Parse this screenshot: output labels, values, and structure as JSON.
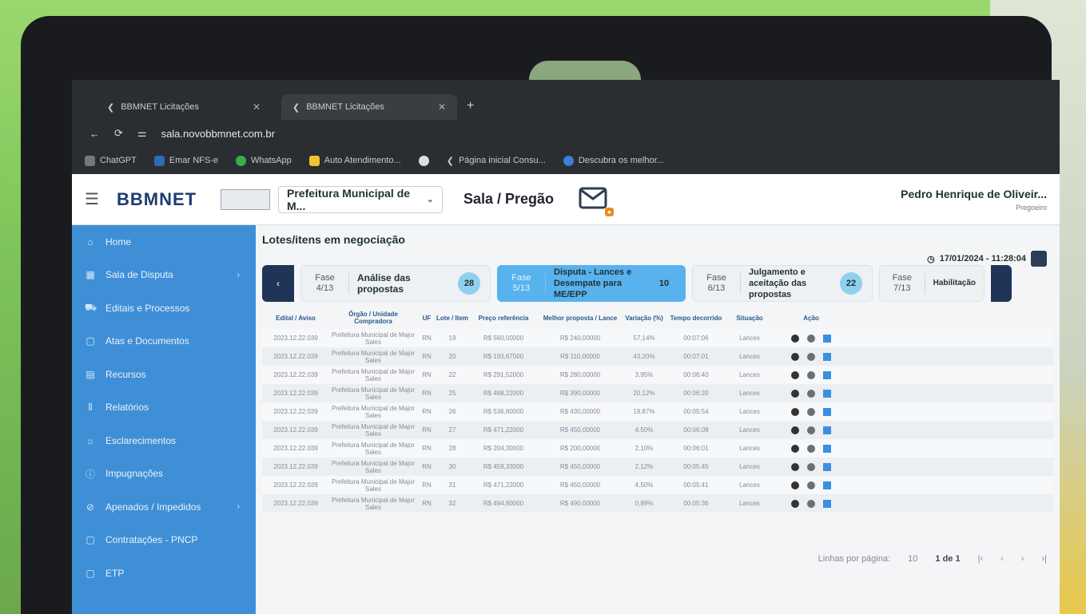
{
  "browser": {
    "tabs": [
      {
        "label": "BBMNET Licitações"
      },
      {
        "label": "BBMNET Licitações"
      }
    ],
    "url": "sala.novobbmnet.com.br",
    "bookmarks": [
      {
        "label": "ChatGPT"
      },
      {
        "label": "Emar NFS-e"
      },
      {
        "label": "WhatsApp"
      },
      {
        "label": "Auto Atendimento..."
      },
      {
        "label": "Página inicial Consu..."
      },
      {
        "label": "Descubra os melhor..."
      }
    ]
  },
  "header": {
    "logo": "BBMNET",
    "org_select": "Prefeitura Municipal de M...",
    "page_title": "Sala / Pregão",
    "user_name": "Pedro Henrique de Oliveir...",
    "user_role": "Pregoeiro"
  },
  "sidebar": {
    "items": [
      {
        "label": "Home"
      },
      {
        "label": "Sala de Disputa"
      },
      {
        "label": "Editais e Processos"
      },
      {
        "label": "Atas e Documentos"
      },
      {
        "label": "Recursos"
      },
      {
        "label": "Relatórios"
      },
      {
        "label": "Esclarecimentos"
      },
      {
        "label": "Impugnações"
      },
      {
        "label": "Apenados / Impedidos"
      },
      {
        "label": "Contratações - PNCP"
      },
      {
        "label": "ETP"
      }
    ]
  },
  "main": {
    "title": "Lotes/itens em negociação",
    "datetime": "17/01/2024 - 11:28:04",
    "phases": [
      {
        "fase": "Fase",
        "num": "4/13",
        "label": "Análise das propostas",
        "count": "28"
      },
      {
        "fase": "Fase",
        "num": "5/13",
        "label": "Disputa - Lances e Desempate para ME/EPP",
        "count": "10"
      },
      {
        "fase": "Fase",
        "num": "6/13",
        "label": "Julgamento e aceitação das propostas",
        "count": "22"
      },
      {
        "fase": "Fase",
        "num": "7/13",
        "label": "Habilitação",
        "count": ""
      }
    ],
    "columns": [
      "Edital / Aviso",
      "Órgão / Unidade Compradora",
      "UF",
      "Lote / Item",
      "Preço referência",
      "Melhor proposta / Lance",
      "Variação (%)",
      "Tempo decorrido",
      "Situação",
      "Ação"
    ],
    "rows": [
      {
        "edital": "2023.12.22.039",
        "orgao": "Prefeitura Municipal de Major Sales",
        "uf": "RN",
        "lote": "19",
        "preco": "R$ 560,00000",
        "melhor": "R$ 240,00000",
        "variacao": "57,14%",
        "tempo": "00:07:06",
        "situacao": "Lances"
      },
      {
        "edital": "2023.12.22.039",
        "orgao": "Prefeitura Municipal de Major Sales",
        "uf": "RN",
        "lote": "20",
        "preco": "R$ 193,67000",
        "melhor": "R$ 110,00000",
        "variacao": "43,20%",
        "tempo": "00:07:01",
        "situacao": "Lances"
      },
      {
        "edital": "2023.12.22.039",
        "orgao": "Prefeitura Municipal de Major Sales",
        "uf": "RN",
        "lote": "22",
        "preco": "R$ 291,52000",
        "melhor": "R$ 280,00000",
        "variacao": "3,95%",
        "tempo": "00:06:40",
        "situacao": "Lances"
      },
      {
        "edital": "2023.12.22.039",
        "orgao": "Prefeitura Municipal de Major Sales",
        "uf": "RN",
        "lote": "25",
        "preco": "R$ 488,22000",
        "melhor": "R$ 390,00000",
        "variacao": "20,12%",
        "tempo": "00:06:20",
        "situacao": "Lances"
      },
      {
        "edital": "2023.12.22.039",
        "orgao": "Prefeitura Municipal de Major Sales",
        "uf": "RN",
        "lote": "26",
        "preco": "R$ 536,80000",
        "melhor": "R$ 430,00000",
        "variacao": "19,87%",
        "tempo": "00:05:54",
        "situacao": "Lances"
      },
      {
        "edital": "2023.12.22.039",
        "orgao": "Prefeitura Municipal de Major Sales",
        "uf": "RN",
        "lote": "27",
        "preco": "R$ 471,22000",
        "melhor": "R$ 450,00000",
        "variacao": "4,50%",
        "tempo": "00:06:08",
        "situacao": "Lances"
      },
      {
        "edital": "2023.12.22.039",
        "orgao": "Prefeitura Municipal de Major Sales",
        "uf": "RN",
        "lote": "28",
        "preco": "R$ 204,30000",
        "melhor": "R$ 200,00000",
        "variacao": "2,10%",
        "tempo": "00:06:01",
        "situacao": "Lances"
      },
      {
        "edital": "2023.12.22.039",
        "orgao": "Prefeitura Municipal de Major Sales",
        "uf": "RN",
        "lote": "30",
        "preco": "R$ 459,33000",
        "melhor": "R$ 450,00000",
        "variacao": "2,12%",
        "tempo": "00:05:45",
        "situacao": "Lances"
      },
      {
        "edital": "2023.12.22.039",
        "orgao": "Prefeitura Municipal de Major Sales",
        "uf": "RN",
        "lote": "31",
        "preco": "R$ 471,22000",
        "melhor": "R$ 450,00000",
        "variacao": "4,50%",
        "tempo": "00:05:41",
        "situacao": "Lances"
      },
      {
        "edital": "2023.12.22.039",
        "orgao": "Prefeitura Municipal de Major Sales",
        "uf": "RN",
        "lote": "32",
        "preco": "R$ 494,80000",
        "melhor": "R$ 490,00000",
        "variacao": "0,89%",
        "tempo": "00:05:36",
        "situacao": "Lances"
      }
    ],
    "pager": {
      "label": "Linhas por página:",
      "per_page": "10",
      "range": "1 de 1"
    }
  }
}
